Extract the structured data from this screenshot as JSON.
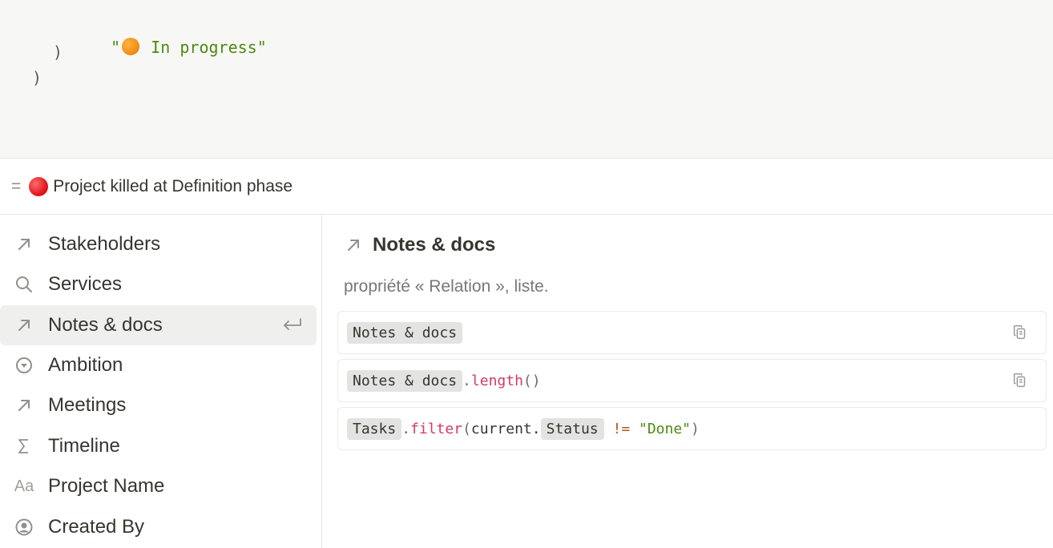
{
  "editor": {
    "line1_quote_open": "\"",
    "line1_emoji": "orange-circle",
    "line1_text": " In progress\"",
    "line2": ")",
    "line3": ")"
  },
  "result": {
    "equals": "=",
    "emoji": "red-circle",
    "text": "Project killed at Definition phase"
  },
  "sidebar": {
    "items": [
      {
        "label": "Stakeholders",
        "icon": "arrow-up-right-icon"
      },
      {
        "label": "Services",
        "icon": "search-icon"
      },
      {
        "label": "Notes & docs",
        "icon": "arrow-up-right-icon",
        "active": true
      },
      {
        "label": "Ambition",
        "icon": "select-circle-icon"
      },
      {
        "label": "Meetings",
        "icon": "arrow-up-right-icon"
      },
      {
        "label": "Timeline",
        "icon": "sigma-icon"
      },
      {
        "label": "Project Name",
        "icon": "text-aa-icon",
        "icon_text": "Aa"
      },
      {
        "label": "Created By",
        "icon": "user-circle-icon"
      }
    ]
  },
  "detail": {
    "title": "Notes & docs",
    "description": "propriété « Relation », liste.",
    "examples": {
      "ex1": {
        "chip": "Notes & docs"
      },
      "ex2": {
        "chip": "Notes & docs",
        "dot": ".",
        "fn": "length",
        "parens": "()"
      },
      "ex3": {
        "chip1": "Tasks",
        "dot": ".",
        "fn": "filter",
        "open": "(",
        "arg": "current.",
        "chip2": "Status",
        "op": " != ",
        "str": "\"Done\"",
        "close": ")"
      }
    }
  },
  "colors": {
    "string": "#4d8a10",
    "function": "#d13b62",
    "operator": "#b5531b",
    "chip_bg": "#e3e3e1",
    "active_bg": "#efefee"
  }
}
